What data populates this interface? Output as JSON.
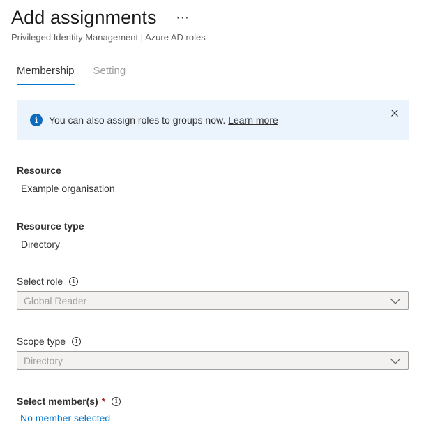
{
  "header": {
    "title": "Add assignments",
    "more_label": "···",
    "subtitle": "Privileged Identity Management | Azure AD roles"
  },
  "tabs": [
    {
      "label": "Membership",
      "active": true
    },
    {
      "label": "Setting",
      "active": false
    }
  ],
  "banner": {
    "icon": "info-icon",
    "text": "You can also assign roles to groups now.",
    "link_label": "Learn more"
  },
  "resource": {
    "label": "Resource",
    "value": "Example organisation"
  },
  "resource_type": {
    "label": "Resource type",
    "value": "Directory"
  },
  "select_role": {
    "label": "Select role",
    "value": "Global Reader"
  },
  "scope_type": {
    "label": "Scope type",
    "value": "Directory"
  },
  "select_members": {
    "label": "Select member(s)",
    "required_marker": "*",
    "link_label": "No member selected"
  },
  "colors": {
    "accent": "#0078d4",
    "banner_bg": "#ebf3fc",
    "required": "#a4262c"
  }
}
